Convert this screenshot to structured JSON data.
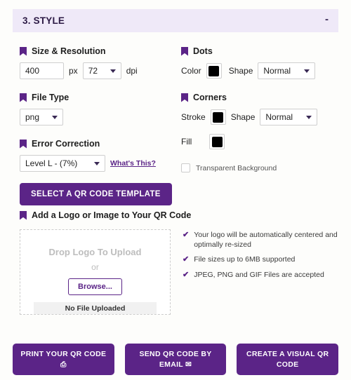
{
  "section": {
    "title": "3. STYLE",
    "collapse_label": "-"
  },
  "size_resolution": {
    "heading": "Size & Resolution",
    "size_value": "400",
    "size_unit": "px",
    "dpi_value": "72",
    "dpi_unit": "dpi"
  },
  "file_type": {
    "heading": "File Type",
    "value": "png"
  },
  "error_correction": {
    "heading": "Error Correction",
    "value": "Level L - (7%)",
    "help_link": "What's This?"
  },
  "template_button": {
    "label": "SELECT A QR CODE TEMPLATE"
  },
  "dots": {
    "heading": "Dots",
    "color_label": "Color",
    "color_value": "#000000",
    "shape_label": "Shape",
    "shape_value": "Normal"
  },
  "corners": {
    "heading": "Corners",
    "stroke_label": "Stroke",
    "stroke_value": "#000000",
    "shape_label": "Shape",
    "shape_value": "Normal",
    "fill_label": "Fill",
    "fill_value": "#000000"
  },
  "transparent_background": {
    "label": "Transparent Background",
    "checked": false
  },
  "logo": {
    "heading": "Add a Logo or Image to Your QR Code",
    "drop_text": "Drop Logo To Upload",
    "or_text": "or",
    "browse_label": "Browse...",
    "no_file_label": "No File Uploaded",
    "bullets": [
      "Your logo will be automatically centered and optimally re-sized",
      "File sizes up to 6MB supported",
      "JPEG, PNG and GIF Files are accepted"
    ],
    "check_glyph": "✔"
  },
  "footer": {
    "print_label": "PRINT YOUR QR CODE",
    "print_icon": "⎙",
    "email_label": "SEND QR CODE BY EMAIL",
    "email_icon": "✉",
    "visual_label": "CREATE A VISUAL QR CODE"
  },
  "colors": {
    "brand_purple": "#5b2487",
    "header_bg": "#efe9f8",
    "page_bg": "#fdfdfb"
  }
}
